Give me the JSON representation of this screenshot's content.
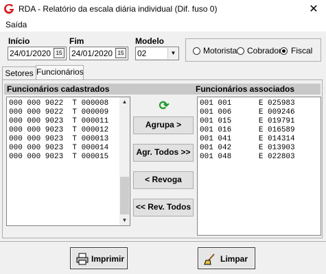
{
  "window": {
    "title": "RDA - Relatório da escala diária individual (Dif. fuso 0)",
    "close_glyph": "✕"
  },
  "menu": {
    "items": [
      {
        "label": "Saída"
      }
    ]
  },
  "form": {
    "inicio_label": "Início",
    "inicio_value": "24/01/2020",
    "fim_label": "Fim",
    "fim_value": "24/01/2020",
    "calendar_glyph": "15",
    "modelo_label": "Modelo",
    "modelo_value": "02",
    "dropdown_glyph": "▼",
    "role_options": [
      {
        "label": "Motorista",
        "selected": false
      },
      {
        "label": "Cobrador",
        "selected": false
      },
      {
        "label": "Fiscal",
        "selected": true
      }
    ]
  },
  "tabs": [
    {
      "label": "Setores",
      "active": false
    },
    {
      "label": "Funcionários",
      "active": true
    }
  ],
  "panel": {
    "left_header": "Funcionários cadastrados",
    "right_header": "Funcionários associados",
    "cadastrados": [
      "000 000 9022  T 000008",
      "000 000 9022  T 000009",
      "000 000 9023  T 000011",
      "000 000 9023  T 000012",
      "000 000 9023  T 000013",
      "000 000 9023  T 000014",
      "000 000 9023  T 000015"
    ],
    "associados": [
      "001 001      E 025983",
      "001 006      E 009246",
      "001 015      E 019791",
      "001 016      E 016589",
      "001 041      E 014314",
      "001 042      E 013903",
      "001 048      E 022803"
    ],
    "scroll_up_glyph": "▲",
    "scroll_down_glyph": "▼",
    "refresh_glyph": "⟳",
    "btn_agrupa": "Agrupa >",
    "btn_agr_todos": "Agr. Todos >>",
    "btn_revoga": "< Revoga",
    "btn_rev_todos": "<< Rev. Todos"
  },
  "footer": {
    "imprimir_label": "Imprimir",
    "limpar_label": "Limpar"
  },
  "colors": {
    "logo_red": "#d62020",
    "refresh_green": "#1a9a2a",
    "header_bar": "#c8c8c8"
  }
}
